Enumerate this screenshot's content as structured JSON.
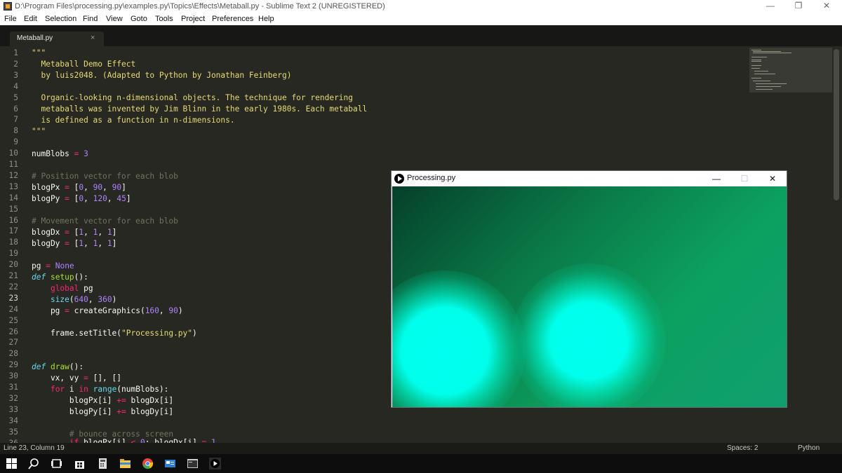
{
  "window": {
    "title": "D:\\Program Files\\processing.py\\examples.py\\Topics\\Effects\\Metaball.py - Sublime Text 2 (UNREGISTERED)",
    "minimize": "—",
    "maximize": "❐",
    "close": "✕"
  },
  "menu": [
    "File",
    "Edit",
    "Selection",
    "Find",
    "View",
    "Goto",
    "Tools",
    "Project",
    "Preferences",
    "Help"
  ],
  "tab": {
    "label": "Metaball.py",
    "close": "×"
  },
  "editor": {
    "active_line": 23,
    "lines": [
      "1",
      "2",
      "3",
      "4",
      "5",
      "6",
      "7",
      "8",
      "9",
      "10",
      "11",
      "12",
      "13",
      "14",
      "15",
      "16",
      "17",
      "18",
      "19",
      "20",
      "21",
      "22",
      "23",
      "24",
      "25",
      "26",
      "27",
      "28",
      "29",
      "30",
      "31",
      "32",
      "33",
      "34",
      "35",
      "36"
    ]
  },
  "status": {
    "position": "Line 23, Column 19",
    "spaces": "Spaces: 2",
    "syntax": "Python"
  },
  "processing_window": {
    "title": "Processing.py",
    "minimize": "—",
    "maximize": "☐",
    "close": "✕"
  },
  "colors": {
    "editor_bg": "#272822",
    "string": "#e6db74",
    "comment": "#75715e",
    "keyword": "#f92672",
    "number": "#ae81ff",
    "blob": "#00ffee"
  },
  "taskbar_icons": [
    "windows-start-icon",
    "search-icon",
    "task-view-icon",
    "store-icon",
    "calculator-icon",
    "file-explorer-icon",
    "chrome-icon",
    "mail-icon",
    "terminal-icon",
    "processing-icon"
  ]
}
